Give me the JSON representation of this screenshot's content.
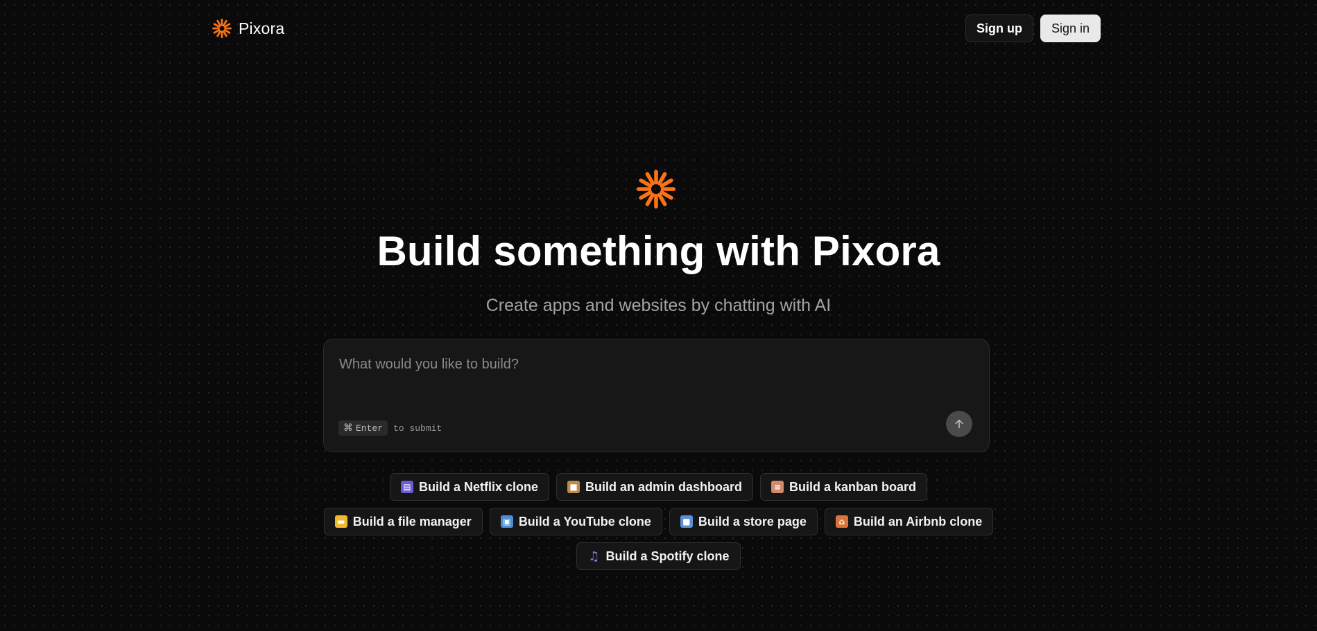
{
  "brand": {
    "name": "Pixora",
    "accent_color": "#f97316"
  },
  "header": {
    "signup_label": "Sign up",
    "signin_label": "Sign in"
  },
  "hero": {
    "title": "Build something with Pixora",
    "subtitle": "Create apps and websites by chatting with AI"
  },
  "prompt": {
    "placeholder": "What would you like to build?",
    "shortcut_key": "Enter",
    "shortcut_hint": "to submit",
    "submit_icon": "arrow-up-icon"
  },
  "suggestions": [
    [
      {
        "label": "Build a Netflix clone",
        "icon": "clapper-board-icon",
        "icon_color": "#6b5bd6"
      },
      {
        "label": "Build an admin dashboard",
        "icon": "package-icon",
        "icon_color": "#c08a4a"
      },
      {
        "label": "Build a kanban board",
        "icon": "clipboard-icon",
        "icon_color": "#d28a6a"
      }
    ],
    [
      {
        "label": "Build a file manager",
        "icon": "folder-icon",
        "icon_color": "#f2b92b"
      },
      {
        "label": "Build a YouTube clone",
        "icon": "television-icon",
        "icon_color": "#4a8fcf"
      },
      {
        "label": "Build a store page",
        "icon": "shopping-bags-icon",
        "icon_color": "#5a8fd8"
      },
      {
        "label": "Build an Airbnb clone",
        "icon": "house-icon",
        "icon_color": "#d9743a"
      }
    ],
    [
      {
        "label": "Build a Spotify clone",
        "icon": "music-note-icon",
        "icon_color": "#8f7be0"
      }
    ]
  ]
}
